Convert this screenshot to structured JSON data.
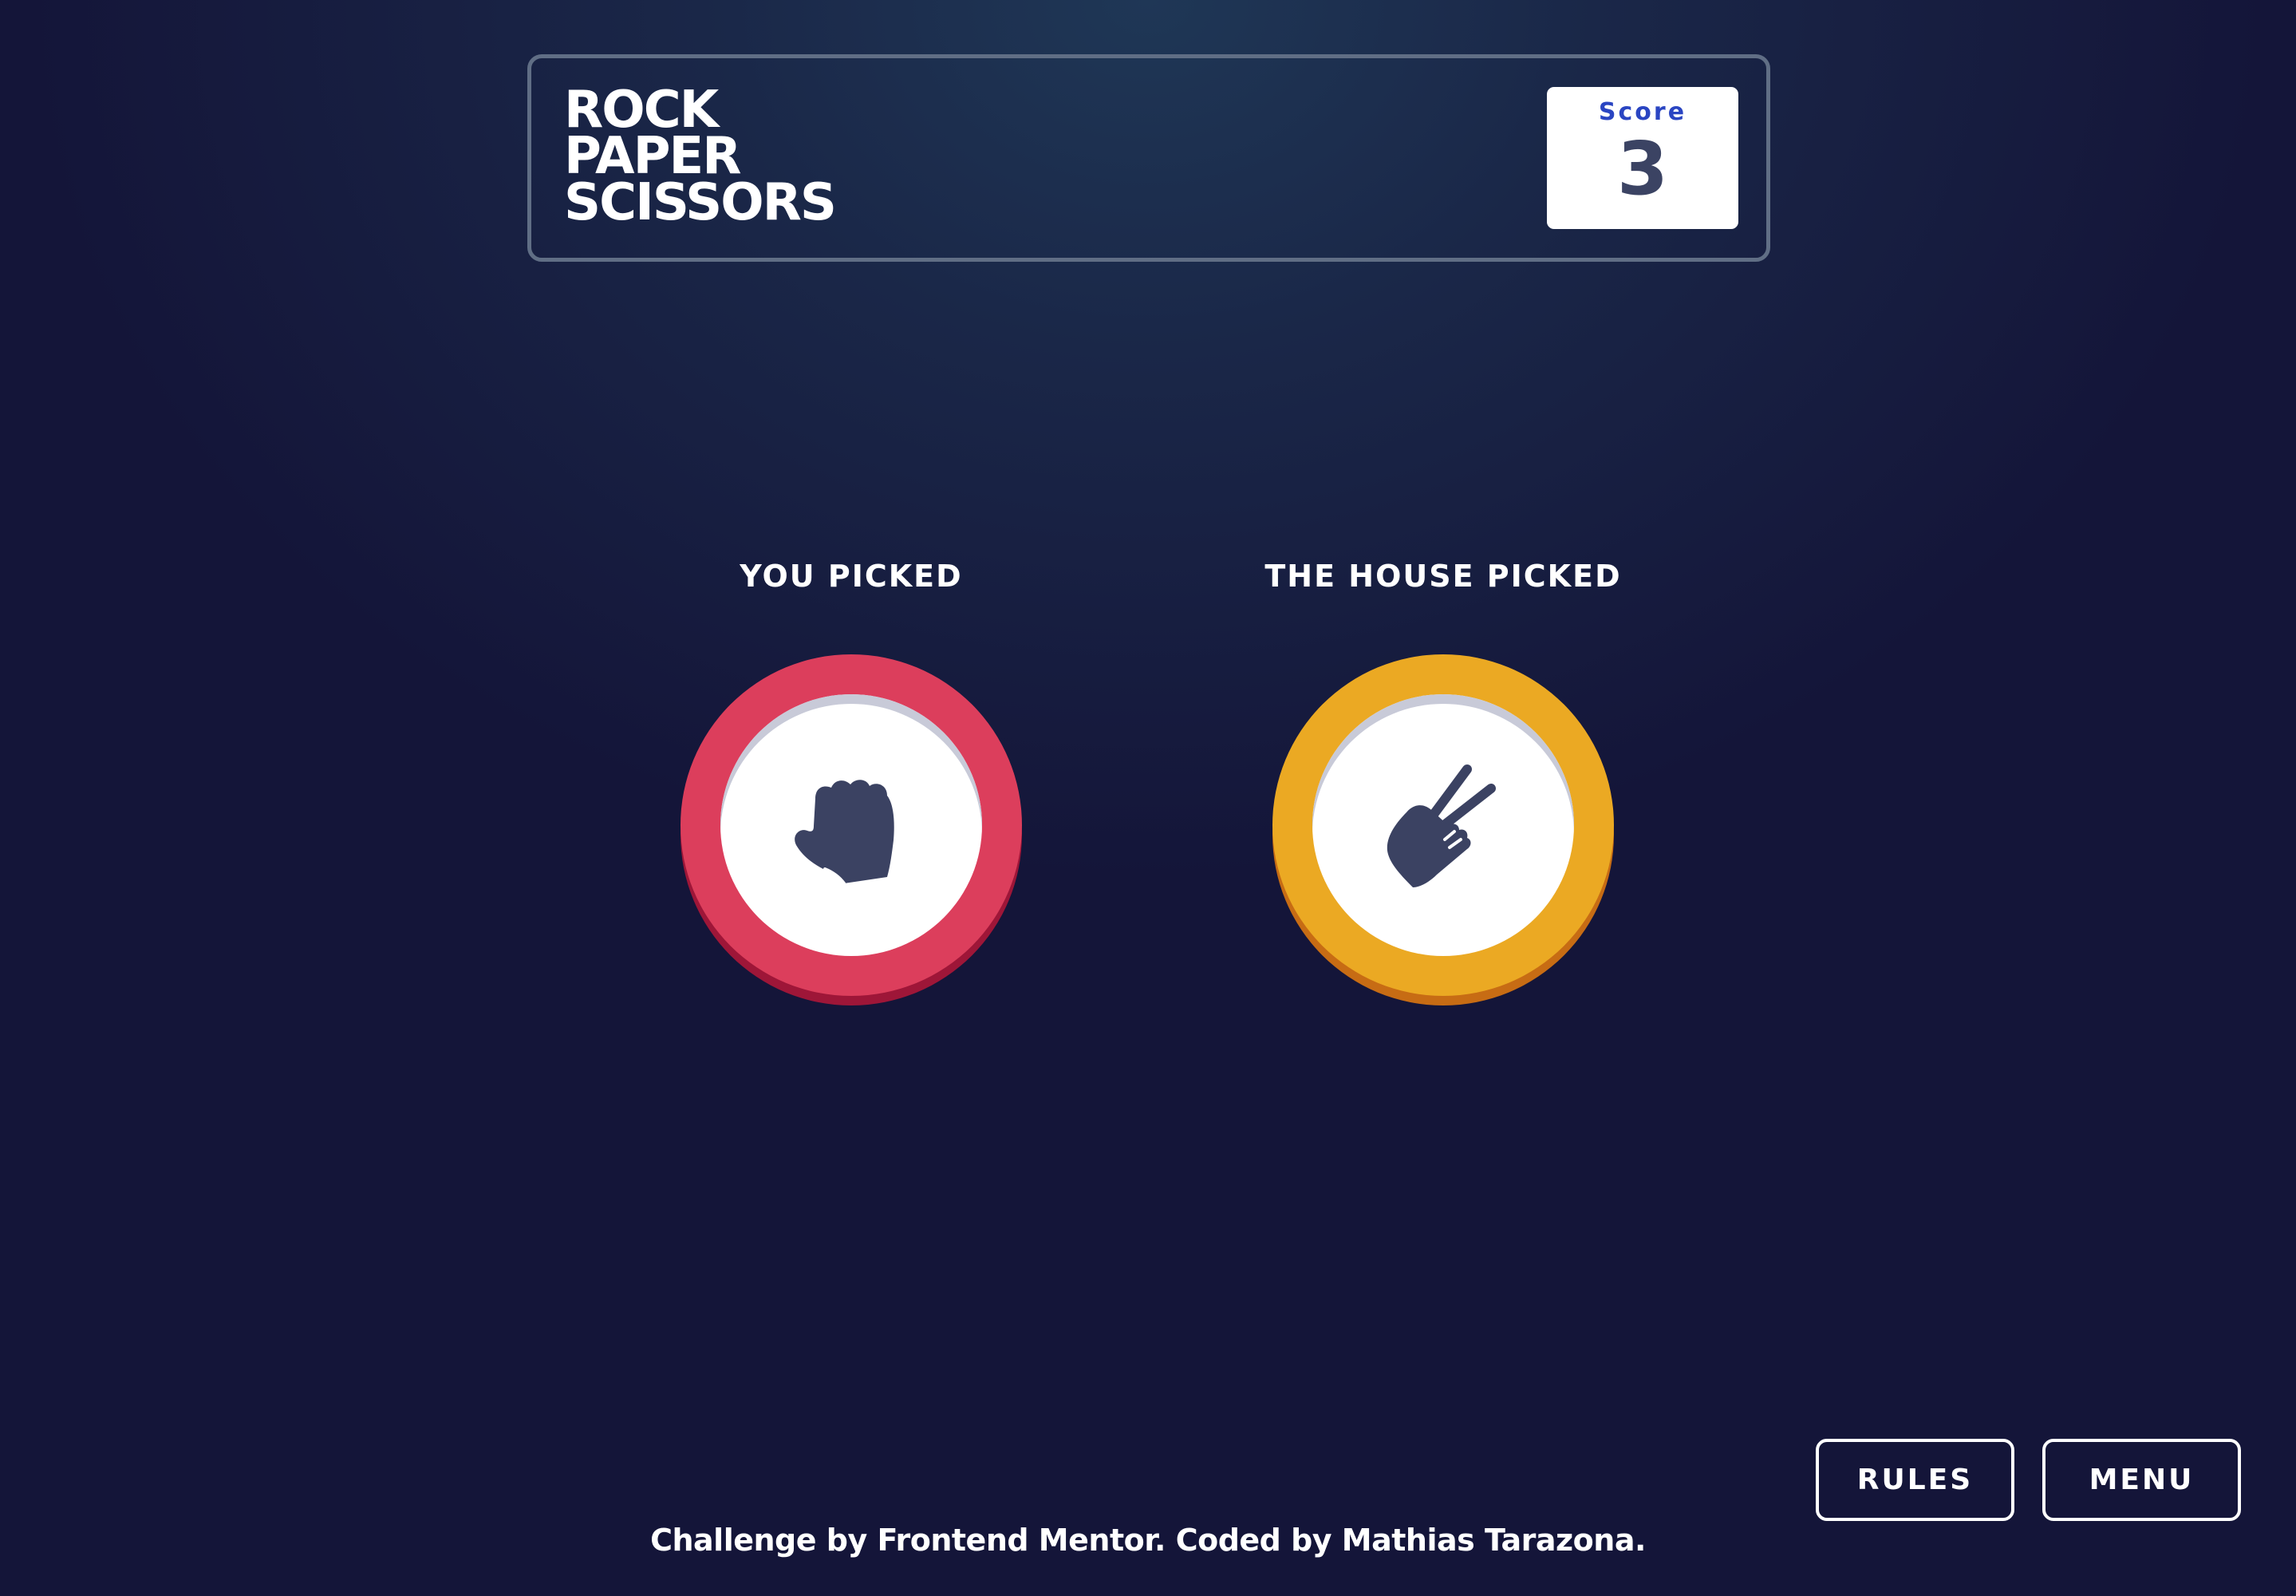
{
  "header": {
    "title_lines": [
      "ROCK",
      "PAPER",
      "SCISSORS"
    ],
    "score_label": "Score",
    "score_value": "3"
  },
  "game": {
    "player_label": "YOU PICKED",
    "house_label": "THE HOUSE PICKED",
    "player_choice": {
      "name": "rock",
      "icon": "rock-fist-icon",
      "ring_color": "#dc3e5c"
    },
    "house_choice": {
      "name": "scissors",
      "icon": "scissors-hand-icon",
      "ring_color": "#eba923"
    }
  },
  "buttons": {
    "rules_label": "RULES",
    "menu_label": "MENU"
  },
  "footer": {
    "credit": "Challenge by Frontend Mentor. Coded by Mathias Tarazona."
  }
}
